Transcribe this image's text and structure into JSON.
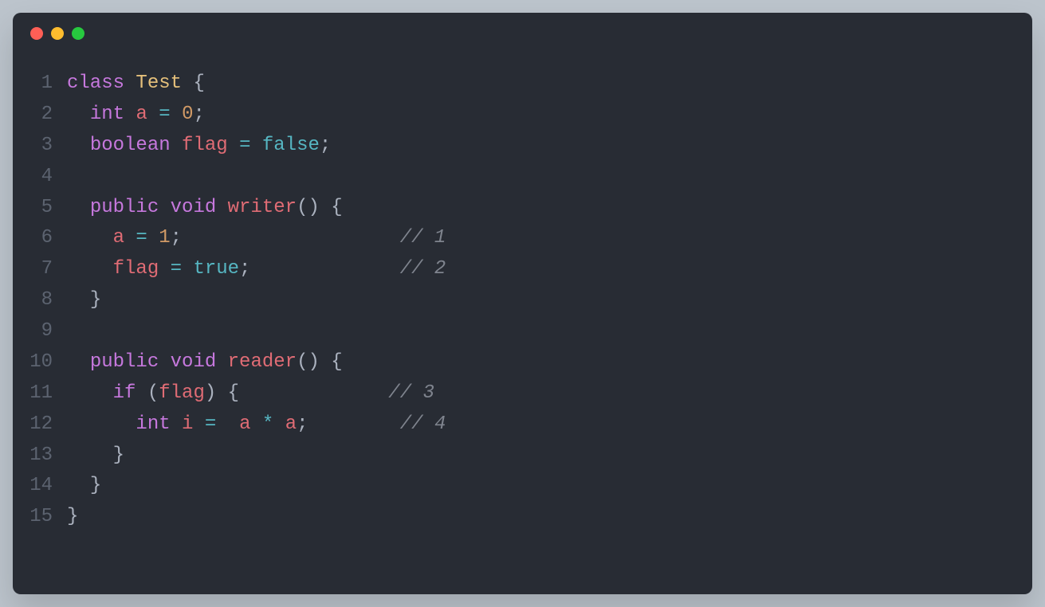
{
  "window": {
    "traffic_lights": [
      "red",
      "yellow",
      "green"
    ]
  },
  "code": {
    "language": "java",
    "lines": [
      {
        "num": "1",
        "tokens": [
          {
            "t": "class",
            "c": "tok-keyword"
          },
          {
            "t": " ",
            "c": "tok-plain"
          },
          {
            "t": "Test",
            "c": "tok-classname"
          },
          {
            "t": " ",
            "c": "tok-plain"
          },
          {
            "t": "{",
            "c": "tok-punct"
          }
        ]
      },
      {
        "num": "2",
        "tokens": [
          {
            "t": "  ",
            "c": "tok-plain"
          },
          {
            "t": "int",
            "c": "tok-type"
          },
          {
            "t": " ",
            "c": "tok-plain"
          },
          {
            "t": "a",
            "c": "tok-var"
          },
          {
            "t": " ",
            "c": "tok-plain"
          },
          {
            "t": "=",
            "c": "tok-op"
          },
          {
            "t": " ",
            "c": "tok-plain"
          },
          {
            "t": "0",
            "c": "tok-number"
          },
          {
            "t": ";",
            "c": "tok-punct"
          }
        ]
      },
      {
        "num": "3",
        "tokens": [
          {
            "t": "  ",
            "c": "tok-plain"
          },
          {
            "t": "boolean",
            "c": "tok-type"
          },
          {
            "t": " ",
            "c": "tok-plain"
          },
          {
            "t": "flag",
            "c": "tok-var"
          },
          {
            "t": " ",
            "c": "tok-plain"
          },
          {
            "t": "=",
            "c": "tok-op"
          },
          {
            "t": " ",
            "c": "tok-plain"
          },
          {
            "t": "false",
            "c": "tok-bool"
          },
          {
            "t": ";",
            "c": "tok-punct"
          }
        ]
      },
      {
        "num": "4",
        "tokens": []
      },
      {
        "num": "5",
        "tokens": [
          {
            "t": "  ",
            "c": "tok-plain"
          },
          {
            "t": "public",
            "c": "tok-keyword"
          },
          {
            "t": " ",
            "c": "tok-plain"
          },
          {
            "t": "void",
            "c": "tok-type"
          },
          {
            "t": " ",
            "c": "tok-plain"
          },
          {
            "t": "writer",
            "c": "tok-func"
          },
          {
            "t": "()",
            "c": "tok-punct"
          },
          {
            "t": " ",
            "c": "tok-plain"
          },
          {
            "t": "{",
            "c": "tok-punct"
          }
        ]
      },
      {
        "num": "6",
        "tokens": [
          {
            "t": "    ",
            "c": "tok-plain"
          },
          {
            "t": "a",
            "c": "tok-var"
          },
          {
            "t": " ",
            "c": "tok-plain"
          },
          {
            "t": "=",
            "c": "tok-op"
          },
          {
            "t": " ",
            "c": "tok-plain"
          },
          {
            "t": "1",
            "c": "tok-number"
          },
          {
            "t": ";",
            "c": "tok-punct"
          },
          {
            "t": "                   ",
            "c": "tok-plain"
          },
          {
            "t": "// 1",
            "c": "tok-comment"
          }
        ]
      },
      {
        "num": "7",
        "tokens": [
          {
            "t": "    ",
            "c": "tok-plain"
          },
          {
            "t": "flag",
            "c": "tok-var"
          },
          {
            "t": " ",
            "c": "tok-plain"
          },
          {
            "t": "=",
            "c": "tok-op"
          },
          {
            "t": " ",
            "c": "tok-plain"
          },
          {
            "t": "true",
            "c": "tok-bool"
          },
          {
            "t": ";",
            "c": "tok-punct"
          },
          {
            "t": "             ",
            "c": "tok-plain"
          },
          {
            "t": "// 2",
            "c": "tok-comment"
          }
        ]
      },
      {
        "num": "8",
        "tokens": [
          {
            "t": "  ",
            "c": "tok-plain"
          },
          {
            "t": "}",
            "c": "tok-punct"
          }
        ]
      },
      {
        "num": "9",
        "tokens": []
      },
      {
        "num": "10",
        "tokens": [
          {
            "t": "  ",
            "c": "tok-plain"
          },
          {
            "t": "public",
            "c": "tok-keyword"
          },
          {
            "t": " ",
            "c": "tok-plain"
          },
          {
            "t": "void",
            "c": "tok-type"
          },
          {
            "t": " ",
            "c": "tok-plain"
          },
          {
            "t": "reader",
            "c": "tok-func"
          },
          {
            "t": "()",
            "c": "tok-punct"
          },
          {
            "t": " ",
            "c": "tok-plain"
          },
          {
            "t": "{",
            "c": "tok-punct"
          }
        ]
      },
      {
        "num": "11",
        "tokens": [
          {
            "t": "    ",
            "c": "tok-plain"
          },
          {
            "t": "if",
            "c": "tok-keyword"
          },
          {
            "t": " ",
            "c": "tok-plain"
          },
          {
            "t": "(",
            "c": "tok-punct"
          },
          {
            "t": "flag",
            "c": "tok-var"
          },
          {
            "t": ")",
            "c": "tok-punct"
          },
          {
            "t": " ",
            "c": "tok-plain"
          },
          {
            "t": "{",
            "c": "tok-punct"
          },
          {
            "t": "             ",
            "c": "tok-plain"
          },
          {
            "t": "// 3",
            "c": "tok-comment"
          }
        ]
      },
      {
        "num": "12",
        "tokens": [
          {
            "t": "      ",
            "c": "tok-plain"
          },
          {
            "t": "int",
            "c": "tok-type"
          },
          {
            "t": " ",
            "c": "tok-plain"
          },
          {
            "t": "i",
            "c": "tok-var"
          },
          {
            "t": " ",
            "c": "tok-plain"
          },
          {
            "t": "=",
            "c": "tok-op"
          },
          {
            "t": "  ",
            "c": "tok-plain"
          },
          {
            "t": "a",
            "c": "tok-var"
          },
          {
            "t": " ",
            "c": "tok-plain"
          },
          {
            "t": "*",
            "c": "tok-op"
          },
          {
            "t": " ",
            "c": "tok-plain"
          },
          {
            "t": "a",
            "c": "tok-var"
          },
          {
            "t": ";",
            "c": "tok-punct"
          },
          {
            "t": "        ",
            "c": "tok-plain"
          },
          {
            "t": "// 4",
            "c": "tok-comment"
          }
        ]
      },
      {
        "num": "13",
        "tokens": [
          {
            "t": "    ",
            "c": "tok-plain"
          },
          {
            "t": "}",
            "c": "tok-punct"
          }
        ]
      },
      {
        "num": "14",
        "tokens": [
          {
            "t": "  ",
            "c": "tok-plain"
          },
          {
            "t": "}",
            "c": "tok-punct"
          }
        ]
      },
      {
        "num": "15",
        "tokens": [
          {
            "t": "}",
            "c": "tok-punct"
          }
        ]
      }
    ]
  }
}
